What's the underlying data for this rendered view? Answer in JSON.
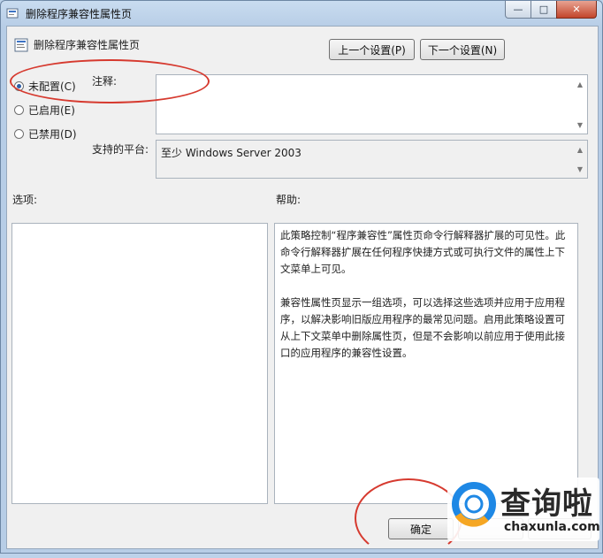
{
  "window": {
    "title": "删除程序兼容性属性页",
    "controls": {
      "minimize": "—",
      "maximize": "□",
      "close": "✕"
    }
  },
  "header": {
    "title": "删除程序兼容性属性页",
    "prev_button": "上一个设置(P)",
    "next_button": "下一个设置(N)"
  },
  "radios": {
    "items": [
      {
        "label": "未配置(C)",
        "selected": true
      },
      {
        "label": "已启用(E)",
        "selected": false
      },
      {
        "label": "已禁用(D)",
        "selected": false
      }
    ]
  },
  "comment": {
    "label": "注释:",
    "value": ""
  },
  "platform": {
    "label": "支持的平台:",
    "value": "至少 Windows Server 2003"
  },
  "options": {
    "label": "选项:"
  },
  "help": {
    "label": "帮助:",
    "paragraphs": [
      "此策略控制“程序兼容性”属性页命令行解释器扩展的可见性。此命令行解释器扩展在任何程序快捷方式或可执行文件的属性上下文菜单上可见。",
      "兼容性属性页显示一组选项，可以选择这些选项并应用于应用程序，以解决影响旧版应用程序的最常见问题。启用此策略设置可从上下文菜单中删除属性页，但是不会影响以前应用于使用此接口的应用程序的兼容性设置。"
    ]
  },
  "footer": {
    "ok_button": "确定"
  },
  "watermark": {
    "name": "查询啦",
    "domain": "chaxunla.com"
  },
  "colors": {
    "annotation": "#d63a2f",
    "logo_blue": "#1e88e5",
    "logo_orange": "#f5a623"
  }
}
